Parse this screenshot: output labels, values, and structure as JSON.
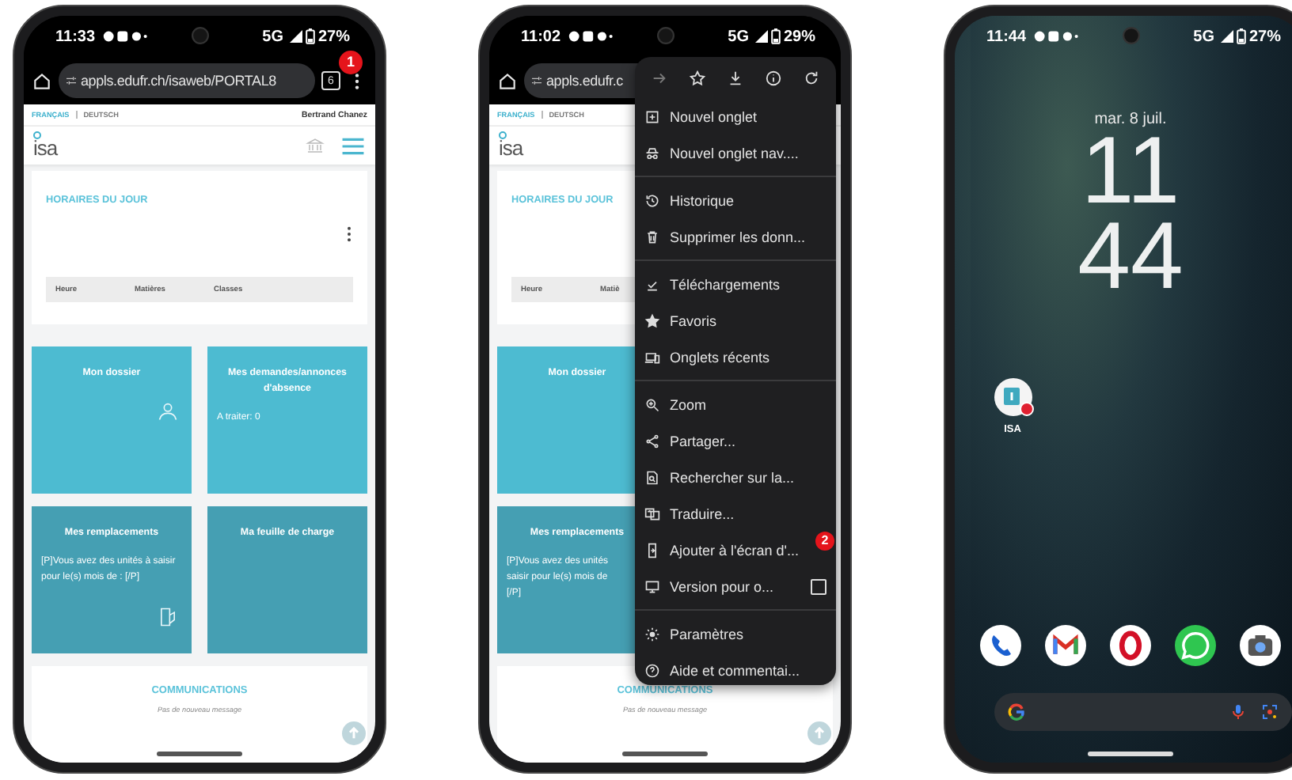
{
  "phones": [
    {
      "kind": "browser",
      "status": {
        "time": "11:33",
        "network": "5G",
        "battery": "27%"
      },
      "toolbar": {
        "url": "appls.edufr.ch/isaweb/PORTAL8",
        "tab_count": "6",
        "badge": "1"
      },
      "page": {
        "languages": [
          {
            "label": "FRANÇAIS",
            "selected": true
          },
          {
            "label": "DEUTSCH",
            "selected": false
          }
        ],
        "user": "Bertrand Chanez",
        "logo": "isa",
        "schedule": {
          "title": "HORAIRES DU JOUR",
          "columns": [
            "Heure",
            "Matières",
            "Classes"
          ]
        },
        "tiles": [
          {
            "kind": "dossier",
            "title": "Mon dossier",
            "color": "#4dbbd1"
          },
          {
            "kind": "requests",
            "title": "Mes demandes/annonces d'absence",
            "color": "#4dbbd1",
            "lines": [
              "A traiter: 0"
            ]
          },
          {
            "kind": "replacements",
            "title": "Mes remplacements",
            "color": "#459fb3",
            "lines": [
              "[P]Vous avez des unités à saisir pour le(s) mois de : [/P]"
            ]
          },
          {
            "kind": "workload",
            "title": "Ma feuille de charge",
            "color": "#459fb3"
          }
        ],
        "communications": {
          "title": "COMMUNICATIONS",
          "message": "Pas de nouveau message"
        }
      }
    },
    {
      "kind": "browser",
      "status": {
        "time": "11:02",
        "network": "5G",
        "battery": "29%"
      },
      "toolbar": {
        "url": "appls.edufr.c"
      },
      "page": {
        "languages": [
          {
            "label": "FRANÇAIS",
            "selected": true
          },
          {
            "label": "DEUTSCH",
            "selected": false
          }
        ],
        "logo": "isa",
        "schedule": {
          "title": "HORAIRES DU JOUR",
          "columns": [
            "Heure",
            "Matiè"
          ]
        },
        "tiles": [
          {
            "kind": "plain",
            "title": "Mon dossier",
            "color": "#4dbbd1"
          },
          {
            "kind": "plain",
            "title": "Mes remplacements",
            "color": "#459fb3",
            "lines": [
              "[P]Vous avez des unités",
              "saisir pour le(s) mois de",
              "[/P]"
            ]
          }
        ],
        "communications": {
          "title": "COMMUNICATIONS",
          "message": "Pas de nouveau message"
        }
      },
      "menu": {
        "groups": [
          {
            "items": [
              {
                "label": "Nouvel onglet",
                "kind": "action"
              },
              {
                "label": "Nouvel onglet nav....",
                "kind": "action"
              }
            ]
          },
          {
            "items": [
              {
                "label": "Historique",
                "kind": "action"
              },
              {
                "label": "Supprimer les donn...",
                "kind": "action"
              }
            ]
          },
          {
            "items": [
              {
                "label": "Téléchargements",
                "kind": "action"
              },
              {
                "label": "Favoris",
                "kind": "action"
              },
              {
                "label": "Onglets récents",
                "kind": "action"
              }
            ]
          },
          {
            "items": [
              {
                "label": "Zoom",
                "kind": "action"
              },
              {
                "label": "Partager...",
                "kind": "action"
              },
              {
                "label": "Rechercher sur la...",
                "kind": "action"
              },
              {
                "label": "Traduire...",
                "kind": "action"
              },
              {
                "label": "Ajouter à l'écran d'...",
                "kind": "action",
                "badge": "2"
              },
              {
                "label": "Version pour o...",
                "kind": "checkbox",
                "checked": false
              }
            ]
          },
          {
            "items": [
              {
                "label": "Paramètres",
                "kind": "action"
              },
              {
                "label": "Aide et commentai...",
                "kind": "action"
              }
            ]
          }
        ]
      }
    },
    {
      "kind": "home",
      "status": {
        "time": "11:44",
        "network": "5G",
        "battery": "27%"
      },
      "date": "mar. 8 juil.",
      "clock": [
        "11",
        "44"
      ],
      "apps": [
        {
          "label": "ISA",
          "notification": true
        }
      ]
    }
  ]
}
